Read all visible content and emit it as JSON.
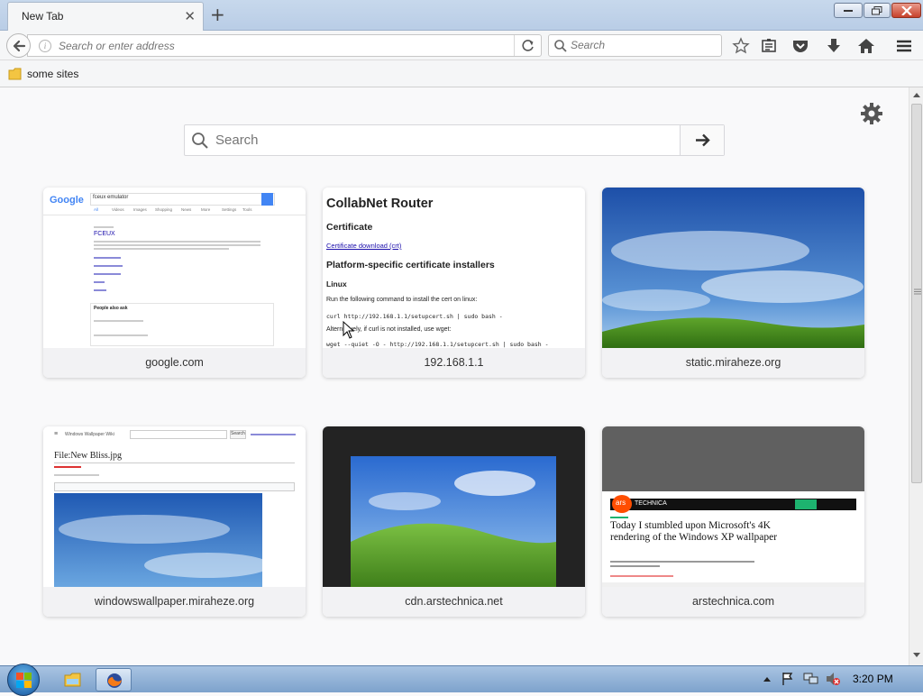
{
  "tab": {
    "title": "New Tab"
  },
  "urlbar": {
    "placeholder": "Search or enter address"
  },
  "searchbar": {
    "placeholder": "Search"
  },
  "bookmarks": {
    "folder": "some sites"
  },
  "newtab": {
    "search_placeholder": "Search",
    "tiles": [
      {
        "label": "google.com"
      },
      {
        "label": "192.168.1.1"
      },
      {
        "label": "static.miraheze.org"
      },
      {
        "label": "windowswallpaper.miraheze.org"
      },
      {
        "label": "cdn.arstechnica.net"
      },
      {
        "label": "arstechnica.com"
      }
    ]
  },
  "thumbs": {
    "google": {
      "logo": "Google",
      "query": "fceux emulator",
      "tabs": [
        "All",
        "Videos",
        "Images",
        "Shopping",
        "News",
        "More",
        "Settings",
        "Tools"
      ],
      "result_title": "FCEUX",
      "paa": "People also ask"
    },
    "router": {
      "title": "CollabNet Router",
      "h_cert": "Certificate",
      "link": "Certificate download (crt)",
      "h_platform": "Platform-specific certificate installers",
      "h_linux": "Linux",
      "p1": "Run the following command to install the cert on linux:",
      "cmd1": "curl http://192.168.1.1/setupcert.sh | sudo bash -",
      "p2": "Alternatively, if curl is not installed, use wget:",
      "cmd2": "wget --quiet -O - http://192.168.1.1/setupcert.sh | sudo bash -"
    },
    "wiki": {
      "site": "Windows Wallpaper Wiki",
      "title": "File:New Bliss.jpg",
      "btn": "Search"
    },
    "ars": {
      "brand": "TECHNICA",
      "logo": "ars",
      "headline": "Today I stumbled upon Microsoft's 4K rendering of the Windows XP wallpaper"
    }
  },
  "taskbar": {
    "time": "3:20 PM"
  },
  "colors": {
    "accent": "#0a84ff",
    "ars_orange": "#ff4e00"
  }
}
